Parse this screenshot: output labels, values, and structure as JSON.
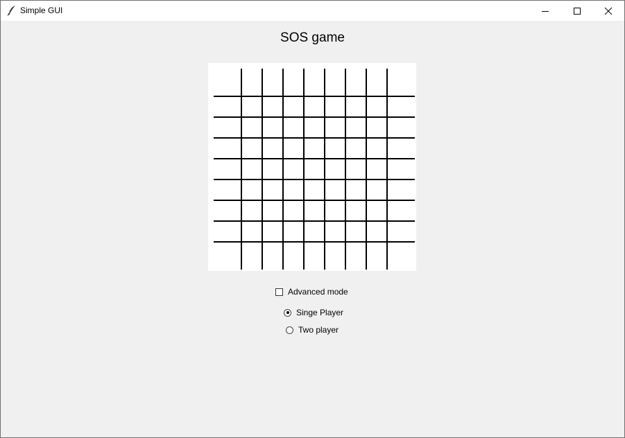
{
  "window": {
    "title": "Simple GUI",
    "minimize_icon": "minimize-icon",
    "maximize_icon": "maximize-icon",
    "close_icon": "close-icon"
  },
  "game": {
    "title": "SOS game",
    "board": {
      "vertical_lines": 8,
      "horizontal_lines": 8
    }
  },
  "options": {
    "advanced_mode_label": "Advanced mode",
    "advanced_mode_checked": false,
    "player_modes": [
      {
        "label": "Singe Player",
        "selected": true
      },
      {
        "label": "Two player",
        "selected": false
      }
    ]
  }
}
